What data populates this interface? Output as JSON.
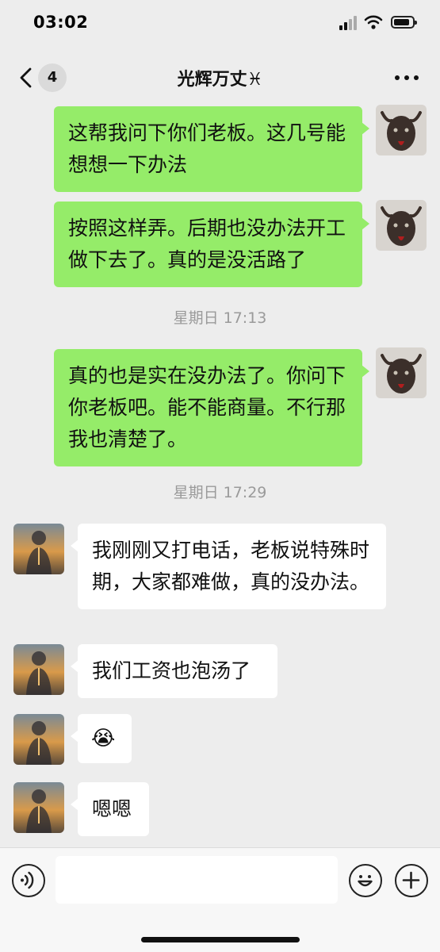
{
  "status_bar": {
    "time": "03:02"
  },
  "header": {
    "unread_count": "4",
    "title": "光辉万丈♓"
  },
  "messages": [
    {
      "side": "out",
      "text": "这帮我问下你们老板。这几号能想想一下办法"
    },
    {
      "side": "out",
      "text": "按照这样弄。后期也没办法开工做下去了。真的是没活路了"
    },
    {
      "type": "time",
      "text": "星期日 17:13"
    },
    {
      "side": "out",
      "text": "真的也是实在没办法了。你问下你老板吧。能不能商量。不行那我也清楚了。"
    },
    {
      "type": "time",
      "text": "星期日 17:29"
    },
    {
      "side": "in",
      "text": "我刚刚又打电话，老板说特殊时期，大家都难做，真的没办法。"
    },
    {
      "side": "in",
      "text": "我们工资也泡汤了"
    },
    {
      "side": "in",
      "text": "😭",
      "icon": "crying-emoji-icon"
    },
    {
      "side": "in",
      "text": "嗯嗯"
    }
  ],
  "input": {
    "placeholder": ""
  },
  "colors": {
    "background": "#ededed",
    "outgoing_bubble": "#95ec69",
    "incoming_bubble": "#ffffff",
    "timestamp": "#9a9a9a"
  },
  "icons": [
    "back-icon",
    "more-icon",
    "voice-icon",
    "emoji-icon",
    "plus-icon",
    "signal-icon",
    "wifi-icon",
    "battery-icon"
  ]
}
